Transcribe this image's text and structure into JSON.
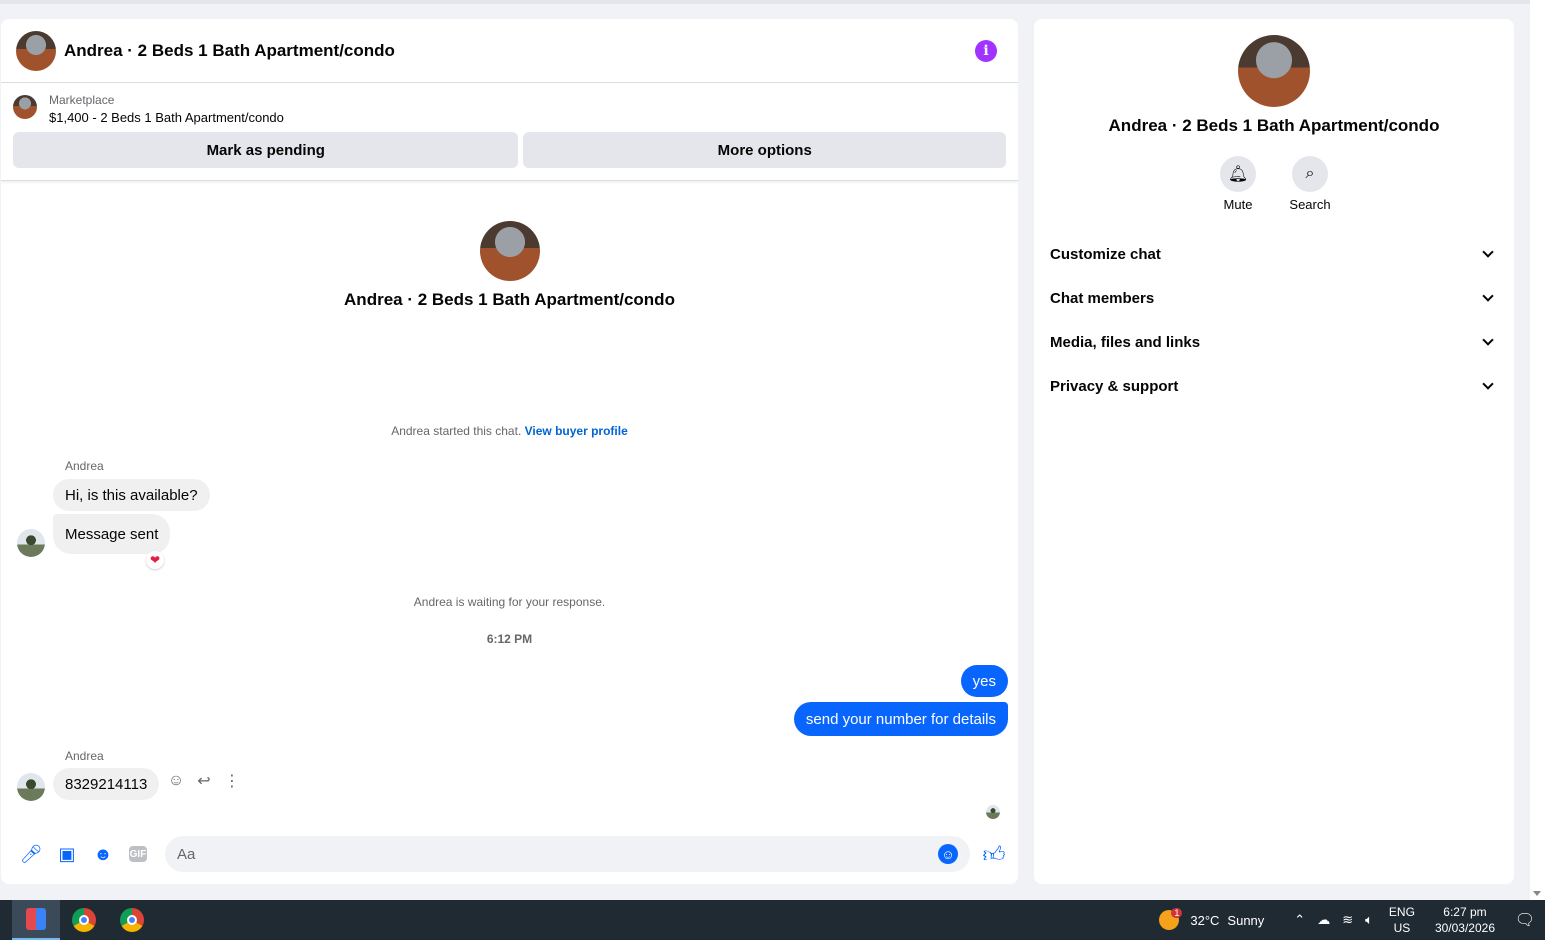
{
  "chat": {
    "title": "Andrea · 2 Beds 1 Bath Apartment/condo",
    "listing": {
      "source": "Marketplace",
      "price_title": "$1,400 - 2 Beds 1 Bath Apartment/condo",
      "pending_label": "Mark as pending",
      "more_label": "More options"
    },
    "intro_title": "Andrea · 2 Beds 1 Bath Apartment/condo",
    "started_text": "Andrea started this chat.",
    "buyer_link": "View buyer profile",
    "messages": {
      "sender_1": "Andrea",
      "msg_1": "Hi, is this available?",
      "msg_2": "Message sent",
      "waiting_text": "Andrea is waiting for your response.",
      "time": "6:12 PM",
      "out_1": "yes",
      "out_2": "send your number for details",
      "sender_2": "Andrea",
      "msg_3": "8329214113"
    },
    "composer": {
      "placeholder": "Aa"
    }
  },
  "side": {
    "title": "Andrea · 2 Beds 1 Bath Apartment/condo",
    "actions": [
      {
        "label": "Mute",
        "icon": "bell-icon"
      },
      {
        "label": "Search",
        "icon": "search-icon"
      }
    ],
    "sections": [
      {
        "label": "Customize chat"
      },
      {
        "label": "Chat members"
      },
      {
        "label": "Media, files and links"
      },
      {
        "label": "Privacy & support"
      }
    ]
  },
  "taskbar": {
    "weather_badge": "1",
    "temperature": "32°C",
    "condition": "Sunny",
    "lang_1": "ENG",
    "lang_2": "US",
    "time": "6:27 pm",
    "date": "30/03/2026"
  },
  "colors": {
    "accent": "#0866ff",
    "info": "#a033ff",
    "reaction": "#e41e3f"
  }
}
